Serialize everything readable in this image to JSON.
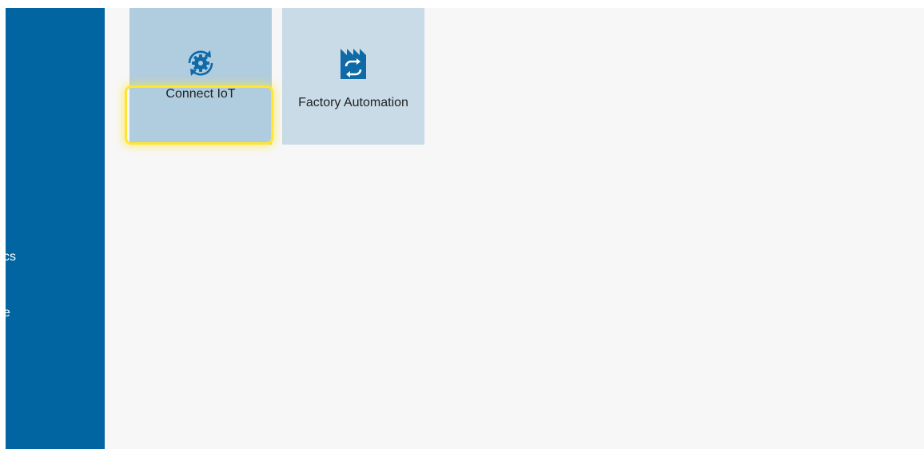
{
  "sidebar": {
    "items": [
      {
        "label": "cs"
      },
      {
        "label": "e"
      }
    ]
  },
  "tiles": [
    {
      "label": "Connect IoT",
      "icon": "gear-sync-icon"
    },
    {
      "label": "Factory Automation",
      "icon": "factory-automation-icon"
    }
  ],
  "colors": {
    "sidebar": "#0065a0",
    "tile_selected": "#b0cde0",
    "tile": "#c8dbe7",
    "icon": "#0f6aa8",
    "highlight": "#ffe533",
    "background": "#f7f7f7"
  }
}
